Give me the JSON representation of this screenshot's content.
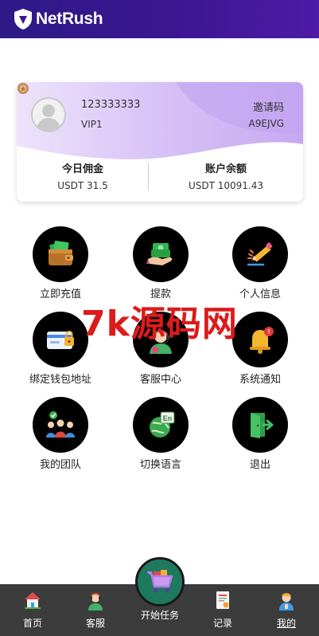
{
  "header": {
    "brand": "NetRush",
    "logo_icon": "shield-icon"
  },
  "account": {
    "user_id": "123333333",
    "level": "VIP1",
    "invite_label": "邀请码",
    "invite_code": "A9EJVG",
    "commission_label": "今日佣金",
    "commission_value": "USDT 31.5",
    "balance_label": "账户余额",
    "balance_value": "USDT 10091.43"
  },
  "menu": [
    {
      "label": "立即充值",
      "icon": "wallet-icon"
    },
    {
      "label": "提款",
      "icon": "cash-hand-icon"
    },
    {
      "label": "个人信息",
      "icon": "pencil-icon"
    },
    {
      "label": "绑定钱包地址",
      "icon": "card-lock-icon"
    },
    {
      "label": "客服中心",
      "icon": "support-agent-icon"
    },
    {
      "label": "系统通知",
      "icon": "bell-icon"
    },
    {
      "label": "我的团队",
      "icon": "team-icon"
    },
    {
      "label": "切换语言",
      "icon": "language-icon"
    },
    {
      "label": "退出",
      "icon": "logout-icon"
    }
  ],
  "watermark": "7k源码网",
  "tabbar": {
    "home": "首页",
    "service": "客服",
    "start_task": "开始任务",
    "records": "记录",
    "mine": "我的"
  }
}
